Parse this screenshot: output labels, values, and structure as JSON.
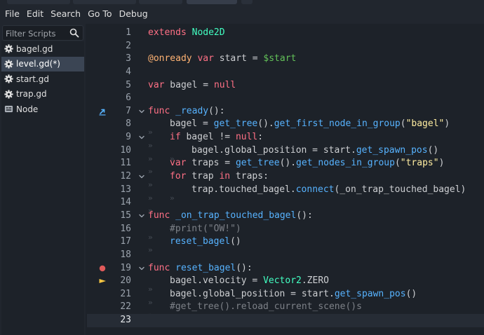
{
  "menu": [
    "File",
    "Edit",
    "Search",
    "Go To",
    "Debug"
  ],
  "filter": {
    "placeholder": "Filter Scripts",
    "icon": "search-icon"
  },
  "scripts": [
    {
      "label": "bagel.gd",
      "icon": "gear-icon",
      "selected": false
    },
    {
      "label": "level.gd(*)",
      "icon": "gear-icon",
      "selected": true
    },
    {
      "label": "start.gd",
      "icon": "gear-icon",
      "selected": false
    },
    {
      "label": "trap.gd",
      "icon": "gear-icon",
      "selected": false
    },
    {
      "label": "Node",
      "icon": "doc-icon",
      "selected": false
    }
  ],
  "code_lines": [
    {
      "n": "1",
      "indent": 0,
      "tokens": [
        [
          "extends",
          "kw"
        ],
        [
          " ",
          "tx"
        ],
        [
          "Node2D",
          "ty"
        ]
      ]
    },
    {
      "n": "2",
      "indent": 0,
      "tokens": []
    },
    {
      "n": "3",
      "indent": 0,
      "tokens": [
        [
          "@onready",
          "ann"
        ],
        [
          " ",
          "tx"
        ],
        [
          "var",
          "kw"
        ],
        [
          " start = ",
          "tx"
        ],
        [
          "$start",
          "nd"
        ]
      ]
    },
    {
      "n": "4",
      "indent": 0,
      "tokens": []
    },
    {
      "n": "5",
      "indent": 0,
      "tokens": [
        [
          "var",
          "kw"
        ],
        [
          " bagel = ",
          "tx"
        ],
        [
          "null",
          "kw"
        ]
      ]
    },
    {
      "n": "6",
      "indent": 0,
      "tokens": []
    },
    {
      "n": "7",
      "indent": 0,
      "marker": "override",
      "fold": true,
      "tokens": [
        [
          "func",
          "kw"
        ],
        [
          " ",
          "tx"
        ],
        [
          "_ready",
          "fn"
        ],
        [
          "():",
          "tx"
        ]
      ]
    },
    {
      "n": "8",
      "indent": 1,
      "tokens": [
        [
          "bagel = ",
          "tx"
        ],
        [
          "get_tree",
          "fn"
        ],
        [
          "().",
          "tx"
        ],
        [
          "get_first_node_in_group",
          "fn"
        ],
        [
          "(",
          "tx"
        ],
        [
          "\"bagel\"",
          "str"
        ],
        [
          ")",
          "tx"
        ]
      ]
    },
    {
      "n": "9",
      "indent": 1,
      "fold": true,
      "tokens": [
        [
          "if",
          "kw"
        ],
        [
          " bagel != ",
          "tx"
        ],
        [
          "null",
          "kw"
        ],
        [
          ":",
          "tx"
        ]
      ]
    },
    {
      "n": "10",
      "indent": 2,
      "tokens": [
        [
          "bagel.global_position = start.",
          "tx"
        ],
        [
          "get_spawn_pos",
          "fn"
        ],
        [
          "()",
          "tx"
        ]
      ]
    },
    {
      "n": "11",
      "indent": 1,
      "tokens": [
        [
          "var",
          "kw"
        ],
        [
          " traps = ",
          "tx"
        ],
        [
          "get_tree",
          "fn"
        ],
        [
          "().",
          "tx"
        ],
        [
          "get_nodes_in_group",
          "fn"
        ],
        [
          "(",
          "tx"
        ],
        [
          "\"traps\"",
          "str"
        ],
        [
          ")",
          "tx"
        ]
      ]
    },
    {
      "n": "12",
      "indent": 1,
      "fold": true,
      "tokens": [
        [
          "for",
          "kw"
        ],
        [
          " trap ",
          "tx"
        ],
        [
          "in",
          "kw"
        ],
        [
          " traps:",
          "tx"
        ]
      ]
    },
    {
      "n": "13",
      "indent": 2,
      "tokens": [
        [
          "trap.touched_bagel.",
          "tx"
        ],
        [
          "connect",
          "fn"
        ],
        [
          "(_on_trap_touched_bagel)",
          "tx"
        ]
      ]
    },
    {
      "n": "14",
      "indent": 1,
      "tokens": []
    },
    {
      "n": "15",
      "indent": 0,
      "fold": true,
      "tokens": [
        [
          "func",
          "kw"
        ],
        [
          " ",
          "tx"
        ],
        [
          "_on_trap_touched_bagel",
          "fn"
        ],
        [
          "():",
          "tx"
        ]
      ]
    },
    {
      "n": "16",
      "indent": 1,
      "tokens": [
        [
          "#print(\"OW!\")",
          "cm"
        ]
      ]
    },
    {
      "n": "17",
      "indent": 1,
      "tokens": [
        [
          "reset_bagel",
          "fn"
        ],
        [
          "()",
          "tx"
        ]
      ]
    },
    {
      "n": "18",
      "indent": 0,
      "tokens": []
    },
    {
      "n": "19",
      "indent": 0,
      "marker": "breakpoint",
      "fold": true,
      "tokens": [
        [
          "func",
          "kw"
        ],
        [
          " ",
          "tx"
        ],
        [
          "reset_bagel",
          "fn"
        ],
        [
          "():",
          "tx"
        ]
      ]
    },
    {
      "n": "20",
      "indent": 1,
      "marker": "execution",
      "tokens": [
        [
          "bagel.velocity = ",
          "tx"
        ],
        [
          "Vector2",
          "ty"
        ],
        [
          ".ZERO",
          "tx"
        ]
      ]
    },
    {
      "n": "21",
      "indent": 1,
      "tokens": [
        [
          "bagel.global_position = start.",
          "tx"
        ],
        [
          "get_spawn_pos",
          "fn"
        ],
        [
          "()",
          "tx"
        ]
      ]
    },
    {
      "n": "22",
      "indent": 1,
      "tokens": [
        [
          "#get_tree().reload_current_scene()s",
          "cm"
        ]
      ]
    },
    {
      "n": "23",
      "indent": 0,
      "current": true,
      "tokens": []
    }
  ]
}
